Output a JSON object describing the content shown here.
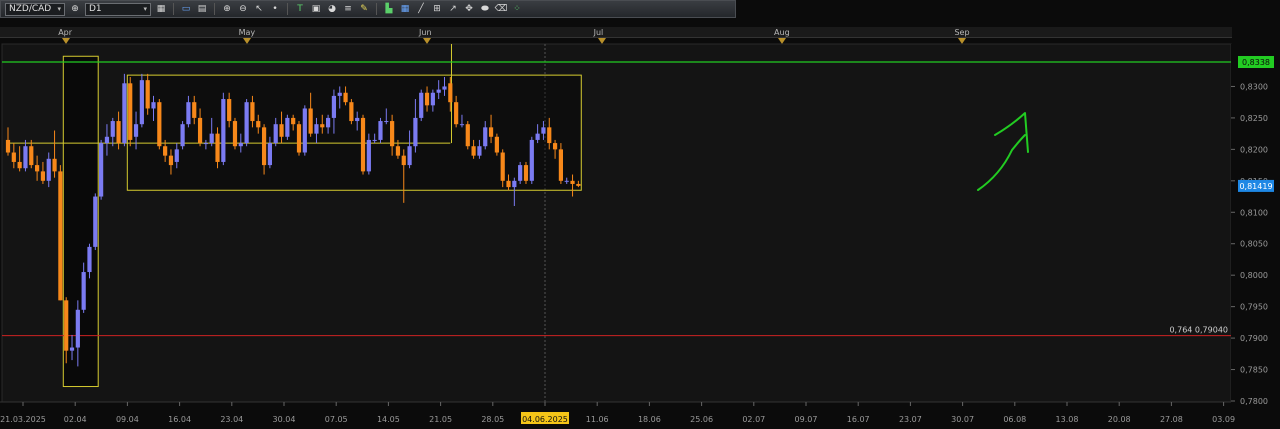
{
  "toolbar": {
    "symbol": "NZD/CAD",
    "timeframe": "D1",
    "icons": [
      "chart-type-icon",
      "crosshair-icon",
      "line-icon",
      "zoom-in-icon",
      "zoom-out-icon",
      "pointer-icon",
      "dot-icon",
      "text-icon",
      "screenshot-icon",
      "palette-icon",
      "fibonacci-icon",
      "pencil-icon",
      "indicator-icon",
      "grid-icon",
      "trendline-icon",
      "channel-icon",
      "arrow-icon",
      "settings-icon",
      "ellipse-icon",
      "eraser-icon",
      "template-icon"
    ]
  },
  "months": [
    {
      "label": "Apr",
      "day": 10
    },
    {
      "label": "May",
      "day": 41
    },
    {
      "label": "Jun",
      "day": 72
    },
    {
      "label": "Jul",
      "day": 102
    },
    {
      "label": "Aug",
      "day": 133
    },
    {
      "label": "Sep",
      "day": 164
    }
  ],
  "colors": {
    "bull": "#7b7bf2",
    "bear": "#f7881a",
    "resistance": "#22cc22",
    "support": "#cc2222",
    "box": "#d6cc30",
    "arrow": "#22cc22",
    "price_tag": "#1e88e5"
  },
  "chart_data": {
    "type": "candlestick",
    "pair": "NZD/CAD",
    "timeframe": "D1",
    "ylim": [
      0.78,
      0.835
    ],
    "y_ticks": [
      "0,8300",
      "0,8250",
      "0,8200",
      "0,8150",
      "0,8100",
      "0,8050",
      "0,8000",
      "0,7950",
      "0,7900",
      "0,7850",
      "0,7800"
    ],
    "x_ticks": [
      "21.03.2025",
      "02.04",
      "09.04",
      "16.04",
      "23.04",
      "30.04",
      "07.05",
      "14.05",
      "21.05",
      "28.05",
      "04.06.2025",
      "11.06",
      "18.06",
      "25.06",
      "02.07",
      "09.07",
      "16.07",
      "23.07",
      "30.07",
      "06.08",
      "13.08",
      "20.08",
      "27.08",
      "03.09"
    ],
    "highlighted_date": "04.06.2025",
    "current_price": "0,81419",
    "resistance_price": "0,8338",
    "resistance_label": "0,8338",
    "support_price": 0.7904,
    "support_label": "0,764 0,79040",
    "candles": [
      {
        "d": 0,
        "o": 0.8215,
        "h": 0.8235,
        "l": 0.819,
        "c": 0.8195
      },
      {
        "d": 1,
        "o": 0.8195,
        "h": 0.821,
        "l": 0.817,
        "c": 0.818
      },
      {
        "d": 2,
        "o": 0.818,
        "h": 0.8205,
        "l": 0.8165,
        "c": 0.817
      },
      {
        "d": 3,
        "o": 0.817,
        "h": 0.8215,
        "l": 0.8165,
        "c": 0.8205
      },
      {
        "d": 4,
        "o": 0.8205,
        "h": 0.8215,
        "l": 0.817,
        "c": 0.8175
      },
      {
        "d": 5,
        "o": 0.8175,
        "h": 0.819,
        "l": 0.815,
        "c": 0.8165
      },
      {
        "d": 6,
        "o": 0.8165,
        "h": 0.818,
        "l": 0.8145,
        "c": 0.815
      },
      {
        "d": 7,
        "o": 0.815,
        "h": 0.8195,
        "l": 0.814,
        "c": 0.8185
      },
      {
        "d": 8,
        "o": 0.8185,
        "h": 0.823,
        "l": 0.8155,
        "c": 0.8165
      },
      {
        "d": 9,
        "o": 0.8165,
        "h": 0.8175,
        "l": 0.796,
        "c": 0.796
      },
      {
        "d": 10,
        "o": 0.796,
        "h": 0.7965,
        "l": 0.786,
        "c": 0.788
      },
      {
        "d": 11,
        "o": 0.788,
        "h": 0.7905,
        "l": 0.7865,
        "c": 0.7885
      },
      {
        "d": 12,
        "o": 0.7885,
        "h": 0.796,
        "l": 0.7855,
        "c": 0.7945
      },
      {
        "d": 13,
        "o": 0.7945,
        "h": 0.802,
        "l": 0.794,
        "c": 0.8005
      },
      {
        "d": 14,
        "o": 0.8005,
        "h": 0.805,
        "l": 0.7995,
        "c": 0.8045
      },
      {
        "d": 15,
        "o": 0.8045,
        "h": 0.813,
        "l": 0.804,
        "c": 0.8125
      },
      {
        "d": 16,
        "o": 0.8125,
        "h": 0.8215,
        "l": 0.812,
        "c": 0.821
      },
      {
        "d": 17,
        "o": 0.821,
        "h": 0.824,
        "l": 0.819,
        "c": 0.822
      },
      {
        "d": 18,
        "o": 0.822,
        "h": 0.825,
        "l": 0.8205,
        "c": 0.8245
      },
      {
        "d": 19,
        "o": 0.8245,
        "h": 0.826,
        "l": 0.82,
        "c": 0.821
      },
      {
        "d": 20,
        "o": 0.821,
        "h": 0.832,
        "l": 0.8205,
        "c": 0.8305
      },
      {
        "d": 21,
        "o": 0.8305,
        "h": 0.8315,
        "l": 0.8205,
        "c": 0.8215
      },
      {
        "d": 22,
        "o": 0.822,
        "h": 0.826,
        "l": 0.82,
        "c": 0.824
      },
      {
        "d": 23,
        "o": 0.824,
        "h": 0.832,
        "l": 0.8235,
        "c": 0.831
      },
      {
        "d": 24,
        "o": 0.831,
        "h": 0.832,
        "l": 0.8255,
        "c": 0.8265
      },
      {
        "d": 25,
        "o": 0.8265,
        "h": 0.8285,
        "l": 0.8245,
        "c": 0.8275
      },
      {
        "d": 26,
        "o": 0.8275,
        "h": 0.828,
        "l": 0.82,
        "c": 0.8205
      },
      {
        "d": 27,
        "o": 0.8205,
        "h": 0.8215,
        "l": 0.818,
        "c": 0.819
      },
      {
        "d": 28,
        "o": 0.819,
        "h": 0.82,
        "l": 0.816,
        "c": 0.8175
      },
      {
        "d": 29,
        "o": 0.818,
        "h": 0.821,
        "l": 0.817,
        "c": 0.82
      },
      {
        "d": 30,
        "o": 0.8205,
        "h": 0.8245,
        "l": 0.82,
        "c": 0.824
      },
      {
        "d": 31,
        "o": 0.824,
        "h": 0.8285,
        "l": 0.8235,
        "c": 0.8275
      },
      {
        "d": 32,
        "o": 0.8275,
        "h": 0.8285,
        "l": 0.824,
        "c": 0.825
      },
      {
        "d": 33,
        "o": 0.825,
        "h": 0.8265,
        "l": 0.8205,
        "c": 0.821
      },
      {
        "d": 34,
        "o": 0.821,
        "h": 0.8215,
        "l": 0.82,
        "c": 0.821
      },
      {
        "d": 35,
        "o": 0.821,
        "h": 0.825,
        "l": 0.8205,
        "c": 0.8225
      },
      {
        "d": 36,
        "o": 0.8225,
        "h": 0.8235,
        "l": 0.817,
        "c": 0.818
      },
      {
        "d": 37,
        "o": 0.818,
        "h": 0.829,
        "l": 0.8175,
        "c": 0.828
      },
      {
        "d": 38,
        "o": 0.828,
        "h": 0.829,
        "l": 0.8235,
        "c": 0.8245
      },
      {
        "d": 39,
        "o": 0.8245,
        "h": 0.825,
        "l": 0.82,
        "c": 0.8205
      },
      {
        "d": 40,
        "o": 0.8205,
        "h": 0.8225,
        "l": 0.8195,
        "c": 0.821
      },
      {
        "d": 41,
        "o": 0.821,
        "h": 0.828,
        "l": 0.8205,
        "c": 0.8275
      },
      {
        "d": 42,
        "o": 0.8275,
        "h": 0.8285,
        "l": 0.8235,
        "c": 0.8245
      },
      {
        "d": 43,
        "o": 0.8245,
        "h": 0.8255,
        "l": 0.8225,
        "c": 0.8235
      },
      {
        "d": 44,
        "o": 0.8235,
        "h": 0.824,
        "l": 0.816,
        "c": 0.8175
      },
      {
        "d": 45,
        "o": 0.8175,
        "h": 0.822,
        "l": 0.817,
        "c": 0.821
      },
      {
        "d": 46,
        "o": 0.821,
        "h": 0.825,
        "l": 0.8205,
        "c": 0.824
      },
      {
        "d": 47,
        "o": 0.824,
        "h": 0.826,
        "l": 0.821,
        "c": 0.822
      },
      {
        "d": 48,
        "o": 0.822,
        "h": 0.8255,
        "l": 0.8215,
        "c": 0.825
      },
      {
        "d": 49,
        "o": 0.825,
        "h": 0.8255,
        "l": 0.823,
        "c": 0.824
      },
      {
        "d": 50,
        "o": 0.824,
        "h": 0.8245,
        "l": 0.819,
        "c": 0.8195
      },
      {
        "d": 51,
        "o": 0.8195,
        "h": 0.827,
        "l": 0.819,
        "c": 0.8265
      },
      {
        "d": 52,
        "o": 0.8265,
        "h": 0.829,
        "l": 0.822,
        "c": 0.8225
      },
      {
        "d": 53,
        "o": 0.8225,
        "h": 0.825,
        "l": 0.821,
        "c": 0.824
      },
      {
        "d": 54,
        "o": 0.824,
        "h": 0.8255,
        "l": 0.8225,
        "c": 0.8235
      },
      {
        "d": 55,
        "o": 0.8235,
        "h": 0.8255,
        "l": 0.8225,
        "c": 0.825
      },
      {
        "d": 56,
        "o": 0.825,
        "h": 0.8295,
        "l": 0.8225,
        "c": 0.8285
      },
      {
        "d": 57,
        "o": 0.8285,
        "h": 0.83,
        "l": 0.8265,
        "c": 0.829
      },
      {
        "d": 58,
        "o": 0.829,
        "h": 0.83,
        "l": 0.827,
        "c": 0.8275
      },
      {
        "d": 59,
        "o": 0.8275,
        "h": 0.828,
        "l": 0.824,
        "c": 0.8245
      },
      {
        "d": 60,
        "o": 0.8245,
        "h": 0.826,
        "l": 0.823,
        "c": 0.825
      },
      {
        "d": 61,
        "o": 0.825,
        "h": 0.8255,
        "l": 0.816,
        "c": 0.8165
      },
      {
        "d": 62,
        "o": 0.8165,
        "h": 0.8225,
        "l": 0.816,
        "c": 0.8215
      },
      {
        "d": 63,
        "o": 0.8215,
        "h": 0.8225,
        "l": 0.821,
        "c": 0.8215
      },
      {
        "d": 64,
        "o": 0.8215,
        "h": 0.825,
        "l": 0.821,
        "c": 0.8245
      },
      {
        "d": 65,
        "o": 0.8245,
        "h": 0.8265,
        "l": 0.824,
        "c": 0.8245
      },
      {
        "d": 66,
        "o": 0.8245,
        "h": 0.8255,
        "l": 0.819,
        "c": 0.8205
      },
      {
        "d": 67,
        "o": 0.8205,
        "h": 0.8215,
        "l": 0.8185,
        "c": 0.819
      },
      {
        "d": 68,
        "o": 0.819,
        "h": 0.82,
        "l": 0.8115,
        "c": 0.8175
      },
      {
        "d": 69,
        "o": 0.8175,
        "h": 0.823,
        "l": 0.817,
        "c": 0.8205
      },
      {
        "d": 70,
        "o": 0.8205,
        "h": 0.828,
        "l": 0.8195,
        "c": 0.825
      },
      {
        "d": 71,
        "o": 0.825,
        "h": 0.8295,
        "l": 0.8245,
        "c": 0.829
      },
      {
        "d": 72,
        "o": 0.829,
        "h": 0.83,
        "l": 0.826,
        "c": 0.827
      },
      {
        "d": 73,
        "o": 0.827,
        "h": 0.8295,
        "l": 0.826,
        "c": 0.829
      },
      {
        "d": 74,
        "o": 0.829,
        "h": 0.831,
        "l": 0.828,
        "c": 0.8295
      },
      {
        "d": 75,
        "o": 0.8295,
        "h": 0.8315,
        "l": 0.8285,
        "c": 0.83
      },
      {
        "d": 76,
        "o": 0.8305,
        "h": 0.8315,
        "l": 0.826,
        "c": 0.8275
      },
      {
        "d": 77,
        "o": 0.8275,
        "h": 0.8285,
        "l": 0.8235,
        "c": 0.824
      },
      {
        "d": 78,
        "o": 0.824,
        "h": 0.8255,
        "l": 0.8235,
        "c": 0.824
      },
      {
        "d": 79,
        "o": 0.824,
        "h": 0.8245,
        "l": 0.82,
        "c": 0.8205
      },
      {
        "d": 80,
        "o": 0.8205,
        "h": 0.8215,
        "l": 0.8185,
        "c": 0.819
      },
      {
        "d": 81,
        "o": 0.819,
        "h": 0.8215,
        "l": 0.8185,
        "c": 0.8205
      },
      {
        "d": 82,
        "o": 0.8205,
        "h": 0.8245,
        "l": 0.82,
        "c": 0.8235
      },
      {
        "d": 83,
        "o": 0.8235,
        "h": 0.8255,
        "l": 0.821,
        "c": 0.822
      },
      {
        "d": 84,
        "o": 0.822,
        "h": 0.8225,
        "l": 0.819,
        "c": 0.8195
      },
      {
        "d": 85,
        "o": 0.8195,
        "h": 0.82,
        "l": 0.814,
        "c": 0.815
      },
      {
        "d": 86,
        "o": 0.815,
        "h": 0.816,
        "l": 0.8135,
        "c": 0.814
      },
      {
        "d": 87,
        "o": 0.814,
        "h": 0.8155,
        "l": 0.811,
        "c": 0.815
      },
      {
        "d": 88,
        "o": 0.815,
        "h": 0.818,
        "l": 0.8145,
        "c": 0.8175
      },
      {
        "d": 89,
        "o": 0.8175,
        "h": 0.818,
        "l": 0.8145,
        "c": 0.815
      },
      {
        "d": 90,
        "o": 0.815,
        "h": 0.822,
        "l": 0.8145,
        "c": 0.8215
      },
      {
        "d": 91,
        "o": 0.8215,
        "h": 0.824,
        "l": 0.821,
        "c": 0.8225
      },
      {
        "d": 92,
        "o": 0.8225,
        "h": 0.8245,
        "l": 0.8215,
        "c": 0.8235
      },
      {
        "d": 93,
        "o": 0.8235,
        "h": 0.825,
        "l": 0.82,
        "c": 0.821
      },
      {
        "d": 94,
        "o": 0.821,
        "h": 0.8215,
        "l": 0.8185,
        "c": 0.82
      },
      {
        "d": 95,
        "o": 0.82,
        "h": 0.821,
        "l": 0.8145,
        "c": 0.815
      },
      {
        "d": 96,
        "o": 0.815,
        "h": 0.8155,
        "l": 0.8145,
        "c": 0.815
      },
      {
        "d": 97,
        "o": 0.815,
        "h": 0.816,
        "l": 0.8125,
        "c": 0.8145
      },
      {
        "d": 98,
        "o": 0.8145,
        "h": 0.815,
        "l": 0.814,
        "c": 0.8142
      }
    ],
    "annotations": {
      "drop_box": {
        "d0": 9.5,
        "d1": 15.5,
        "y0": 0.7823,
        "y1": 0.8348
      },
      "range_box": {
        "d0": 20.5,
        "d1": 98.5,
        "y0": 0.8135,
        "y1": 0.8318
      },
      "upper_line": {
        "d0": 0,
        "d1": 76,
        "y": 0.821
      },
      "vertical_marker_day": 76.2
    }
  }
}
